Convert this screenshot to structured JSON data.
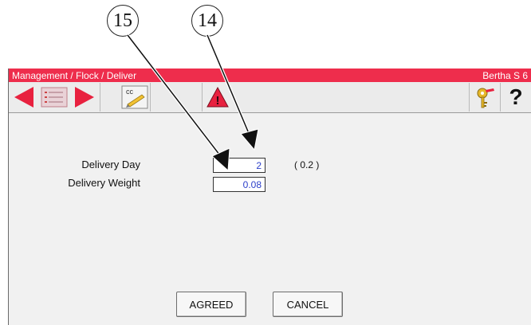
{
  "callouts": {
    "first": "15",
    "second": "14"
  },
  "window": {
    "title": "Management / Flock / Deliver",
    "user": "Bertha S 6"
  },
  "toolbar": {
    "icons": [
      "arrow-left-icon",
      "list-icon",
      "arrow-right-icon",
      "cc-pencil-icon",
      "warning-icon",
      "keys-icon",
      "help-icon"
    ],
    "help_label": "?",
    "cc_label": "cc",
    "warning_label": "!"
  },
  "form": {
    "delivery_day_label": "Delivery Day",
    "delivery_day_value": "2",
    "delivery_day_hint": "( 0.2 )",
    "delivery_weight_label": "Delivery Weight",
    "delivery_weight_value": "0.08"
  },
  "actions": {
    "agreed_label": "AGREED",
    "cancel_label": "CANCEL"
  },
  "colors": {
    "titlebar": "#ee2d4c",
    "arrows": "#e8213f",
    "input_text": "#2b3ec9"
  }
}
